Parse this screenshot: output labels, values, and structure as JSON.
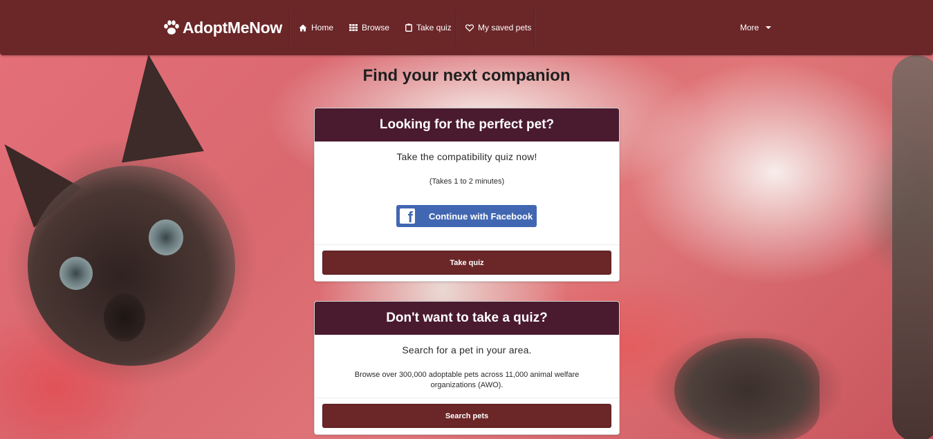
{
  "navbar": {
    "brand": "AdoptMeNow",
    "links": [
      {
        "label": "Home",
        "icon": "home-icon"
      },
      {
        "label": "Browse",
        "icon": "grid-icon"
      },
      {
        "label": "Take quiz",
        "icon": "clipboard-icon"
      },
      {
        "label": "My saved pets",
        "icon": "heart-icon"
      }
    ],
    "more_label": "More",
    "color": "#6b2628"
  },
  "hero": {
    "headline": "Find your next companion",
    "background_image": "cat-photo"
  },
  "quiz_card": {
    "header": "Looking for the perfect pet?",
    "lead": "Take the compatibility quiz now!",
    "note": "(Takes 1 to 2 minutes)",
    "facebook_button": "Continue with Facebook",
    "action_button": "Take quiz",
    "header_color": "#4a1a2e"
  },
  "search_card": {
    "header": "Don't want to take a quiz?",
    "lead": "Search for a pet in your area.",
    "description": "Browse over 300,000 adoptable pets across 11,000 animal welfare organizations (AWO).",
    "action_button": "Search pets"
  },
  "colors": {
    "facebook": "#4267b2",
    "button": "#6b2628"
  }
}
